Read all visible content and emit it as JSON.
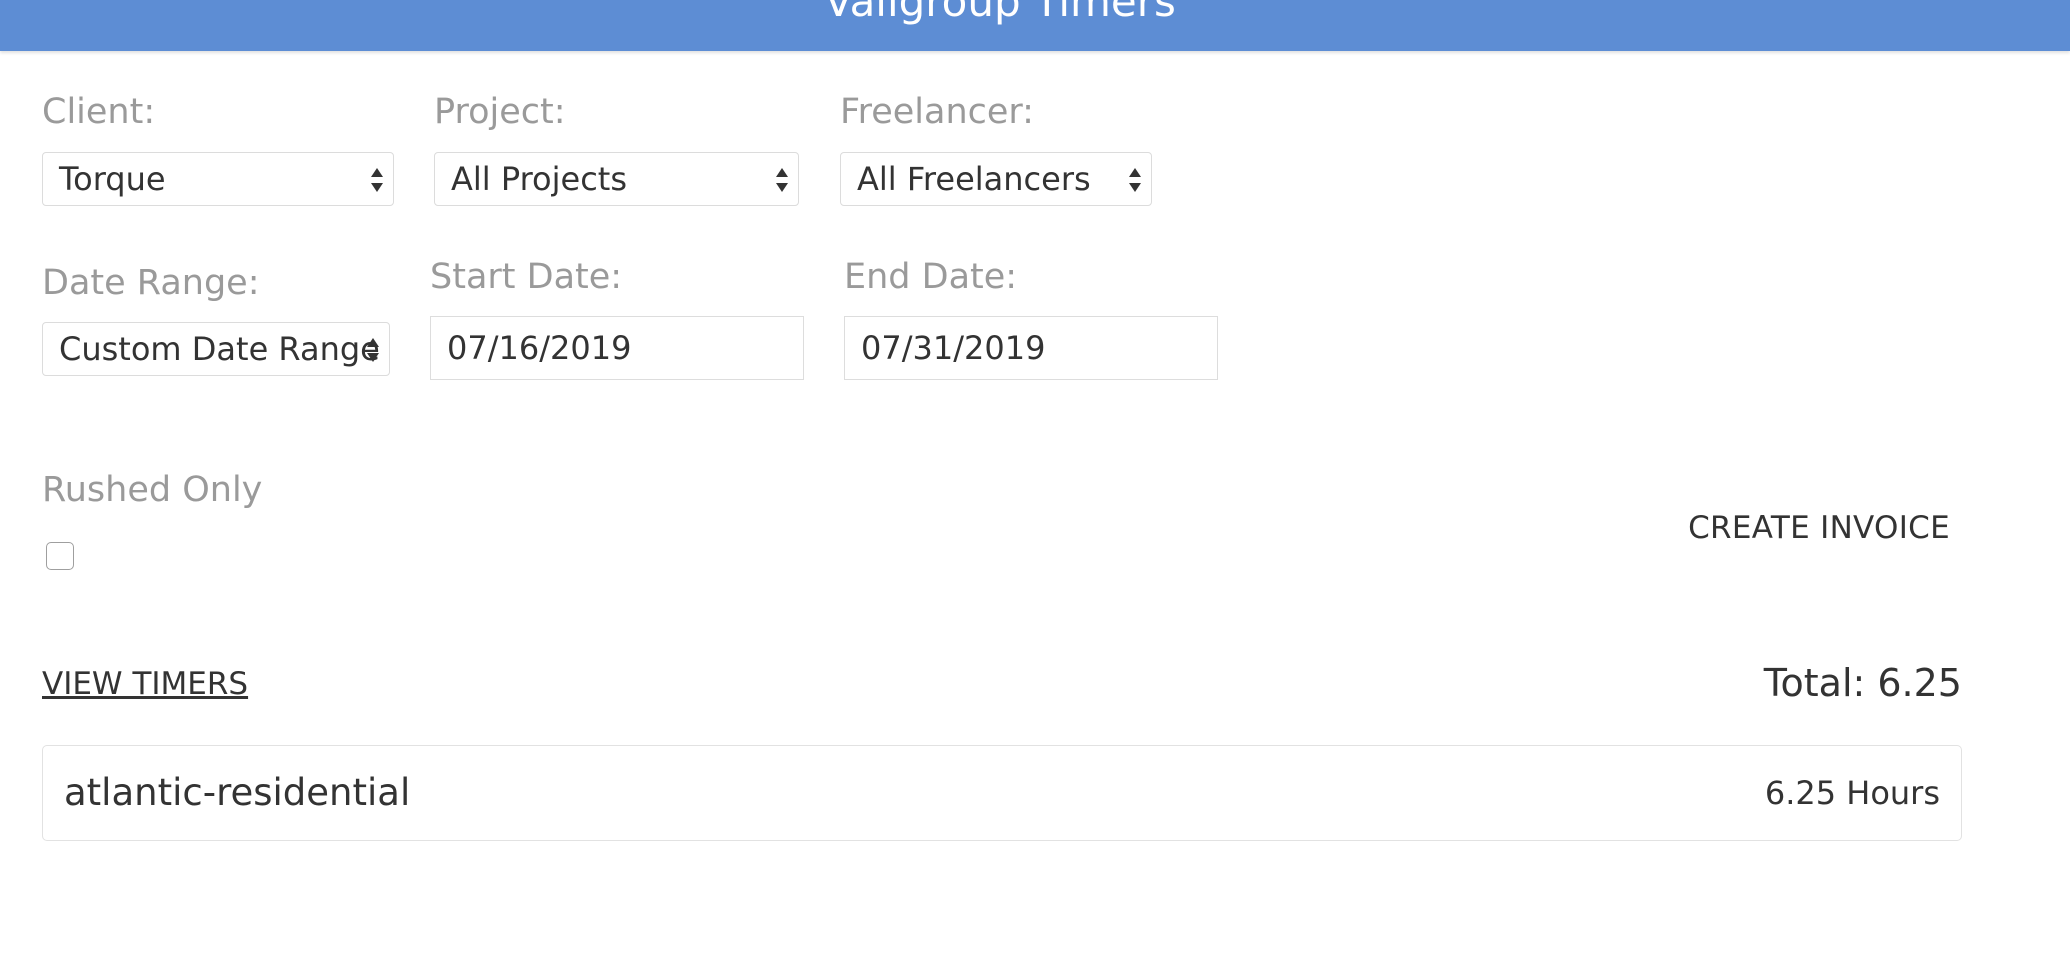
{
  "header": {
    "title": "Valigroup Timers"
  },
  "filters": {
    "client": {
      "label": "Client:",
      "value": "Torque"
    },
    "project": {
      "label": "Project:",
      "value": "All Projects"
    },
    "freelancer": {
      "label": "Freelancer:",
      "value": "All Freelancers"
    },
    "date_range": {
      "label": "Date Range:",
      "value": "Custom Date Range"
    },
    "start_date": {
      "label": "Start Date:",
      "value": "07/16/2019"
    },
    "end_date": {
      "label": "End Date:",
      "value": "07/31/2019"
    },
    "rushed_only": {
      "label": "Rushed Only",
      "checked": false
    }
  },
  "actions": {
    "create_invoice": "CREATE INVOICE",
    "view_timers": "VIEW TIMERS"
  },
  "summary": {
    "total": "Total: 6.25"
  },
  "projects": [
    {
      "name": "atlantic-residential",
      "hours": "6.25 Hours"
    }
  ],
  "colors": {
    "header_bg": "#5d8dd4",
    "label": "#9a9a9a",
    "text": "#333333"
  },
  "icons": {
    "select_arrows": "sort-arrows-icon"
  }
}
